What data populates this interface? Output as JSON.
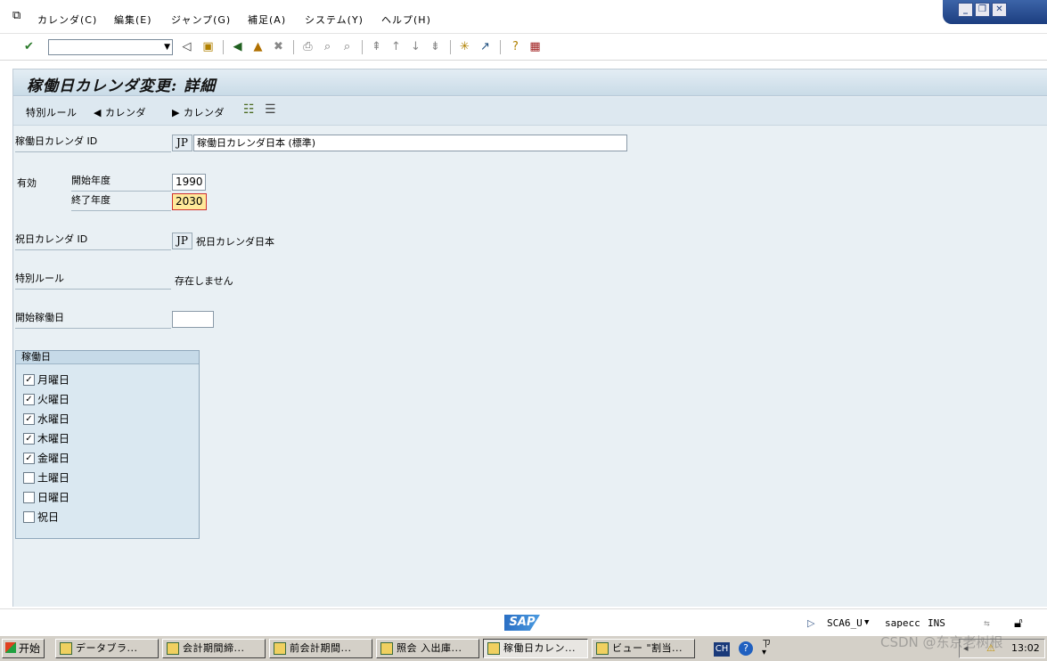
{
  "menu": {
    "items": [
      "カレンダ(C)",
      "編集(E)",
      "ジャンプ(G)",
      "補足(A)",
      "システム(Y)",
      "ヘルプ(H)"
    ]
  },
  "toolbar": {
    "command_value": "",
    "icons": [
      "enter-icon",
      "back-icon",
      "save-icon",
      "nav-back-icon",
      "exit-icon",
      "cancel-icon",
      "print-icon",
      "find-icon",
      "find-next-icon",
      "first-page-icon",
      "prev-page-icon",
      "next-page-icon",
      "last-page-icon",
      "new-session-icon",
      "shortcut-icon",
      "help-icon",
      "layout-icon"
    ]
  },
  "page": {
    "title": "稼働日カレンダ変更: 詳細"
  },
  "app_toolbar": {
    "special_rules": "特別ルール",
    "prev_calendar": "カレンダ",
    "next_calendar": "カレンダ"
  },
  "form": {
    "factory_calendar_label": "稼働日カレンダ ID",
    "factory_calendar_id": "JP",
    "factory_calendar_text": "稼働日カレンダ日本 (標準)",
    "valid_label": "有効",
    "start_year_label": "開始年度",
    "start_year": "1990",
    "end_year_label": "終了年度",
    "end_year": "2030",
    "holiday_calendar_label": "祝日カレンダ ID",
    "holiday_calendar_id": "JP",
    "holiday_calendar_text": "祝日カレンダ日本",
    "special_rules_label": "特別ルール",
    "special_rules_value": "存在しません",
    "start_workday_label": "開始稼働日",
    "start_workday_value": ""
  },
  "workdays": {
    "title": "稼働日",
    "days": [
      {
        "label": "月曜日",
        "checked": true
      },
      {
        "label": "火曜日",
        "checked": true
      },
      {
        "label": "水曜日",
        "checked": true
      },
      {
        "label": "木曜日",
        "checked": true
      },
      {
        "label": "金曜日",
        "checked": true
      },
      {
        "label": "土曜日",
        "checked": false
      },
      {
        "label": "日曜日",
        "checked": false
      },
      {
        "label": "祝日",
        "checked": false
      }
    ]
  },
  "status": {
    "logo": "SAP",
    "system": "SCA6_U",
    "server": "sapecc",
    "mode": "INS"
  },
  "taskbar": {
    "start": "开始",
    "tasks": [
      "データブラ...",
      "会計期間締...",
      "前会計期間...",
      "照会 入出庫...",
      "稼働日カレン...",
      "ビュー \"割当..."
    ],
    "lang": "CH",
    "clock": "13:02"
  },
  "watermark": "CSDN @东京老树根"
}
